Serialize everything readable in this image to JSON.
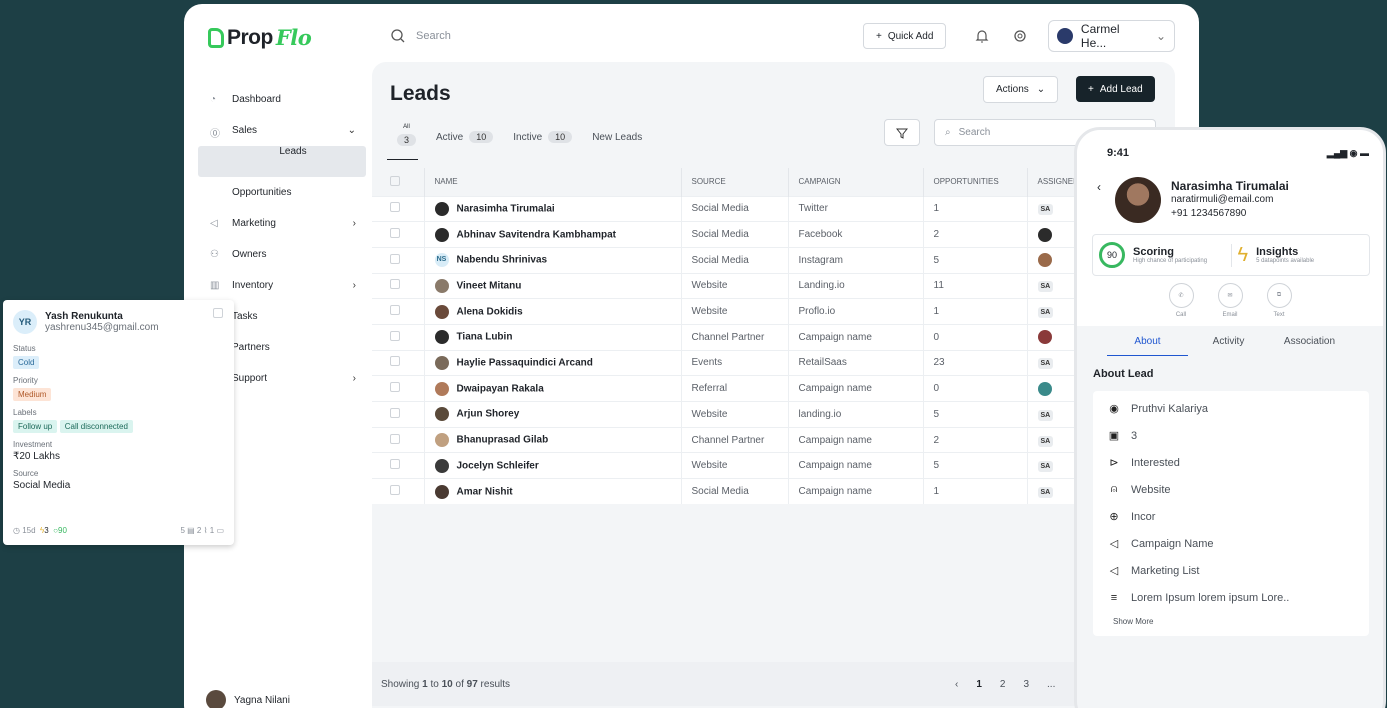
{
  "brand": {
    "name_a": "Prop",
    "name_b": "Flo"
  },
  "top": {
    "search_placeholder": "Search",
    "quick_add": "Quick Add",
    "user": "Carmel He..."
  },
  "sidebar": {
    "items": [
      {
        "label": "Dashboard"
      },
      {
        "label": "Sales"
      },
      {
        "label": "Leads"
      },
      {
        "label": "Opportunities"
      },
      {
        "label": "Marketing"
      },
      {
        "label": "Owners"
      },
      {
        "label": "Inventory"
      },
      {
        "label": "Tasks"
      },
      {
        "label": "Partners"
      },
      {
        "label": "Support"
      }
    ],
    "footer_user": "Yagna Nilani"
  },
  "page": {
    "title": "Leads",
    "actions": "Actions",
    "add_lead": "Add Lead",
    "search_placeholder": "Search"
  },
  "tabs": [
    {
      "label": "All",
      "count": "3"
    },
    {
      "label": "Active",
      "count": "10"
    },
    {
      "label": "Inctive",
      "count": "10"
    },
    {
      "label": "New Leads",
      "count": ""
    }
  ],
  "columns": [
    "NAME",
    "SOURCE",
    "CAMPAIGN",
    "OPPORTUNITIES",
    "ASSIGNED"
  ],
  "rows": [
    {
      "name": "Narasimha Tirumalai",
      "source": "Social Media",
      "campaign": "Twitter",
      "opp": "1",
      "assigned": "SA"
    },
    {
      "name": "Abhinav Savitendra Kambhampat",
      "source": "Social Media",
      "campaign": "Facebook",
      "opp": "2",
      "assigned": ""
    },
    {
      "name": "Nabendu Shrinivas",
      "initials": "NS",
      "source": "Social Media",
      "campaign": "Instagram",
      "opp": "5",
      "assigned": ""
    },
    {
      "name": "Vineet Mitanu",
      "source": "Website",
      "campaign": "Landing.io",
      "opp": "11",
      "assigned": "SA"
    },
    {
      "name": "Alena Dokidis",
      "source": "Website",
      "campaign": "Proflo.io",
      "opp": "1",
      "assigned": "SA"
    },
    {
      "name": "Tiana Lubin",
      "source": "Channel Partner",
      "campaign": "Campaign name",
      "opp": "0",
      "assigned": ""
    },
    {
      "name": "Haylie Passaquindici Arcand",
      "source": "Events",
      "campaign": "RetailSaas",
      "opp": "23",
      "assigned": "SA"
    },
    {
      "name": "Dwaipayan Rakala",
      "source": "Referral",
      "campaign": "Campaign name",
      "opp": "0",
      "assigned": ""
    },
    {
      "name": "Arjun Shorey",
      "source": "Website",
      "campaign": "landing.io",
      "opp": "5",
      "assigned": "SA"
    },
    {
      "name": "Bhanuprasad Gilab",
      "source": "Channel Partner",
      "campaign": "Campaign name",
      "opp": "2",
      "assigned": "SA"
    },
    {
      "name": "Jocelyn Schleifer",
      "source": "Website",
      "campaign": "Campaign name",
      "opp": "5",
      "assigned": "SA"
    },
    {
      "name": "Amar Nishit",
      "source": "Social Media",
      "campaign": "Campaign name",
      "opp": "1",
      "assigned": "SA"
    }
  ],
  "pager": {
    "showing": "Showing",
    "from": "1",
    "to_word": "to",
    "to": "10",
    "of_word": "of",
    "total": "97",
    "results": "results",
    "pages": [
      "1",
      "2",
      "3",
      "..."
    ]
  },
  "card": {
    "initials": "YR",
    "name": "Yash Renukunta",
    "email": "yashrenu345@gmail.com",
    "status_label": "Status",
    "status": "Cold",
    "priority_label": "Priority",
    "priority": "Medium",
    "labels_label": "Labels",
    "labels": [
      "Follow up",
      "Call disconnected"
    ],
    "investment_label": "Investment",
    "investment": "₹20 Lakhs",
    "source_label": "Source",
    "source": "Social Media",
    "days": "15d",
    "bolt": "3",
    "score": "90",
    "docs": "5",
    "attach": "2",
    "comments": "1"
  },
  "phone": {
    "time": "9:41",
    "name": "Narasimha Tirumalai",
    "email": "naratirmuli@email.com",
    "phone": "+91 1234567890",
    "score": "90",
    "scoring": "Scoring",
    "scoring_sub": "High chance of participating",
    "insights": "Insights",
    "insights_sub": "5 datapoints available",
    "call": "Call",
    "email_btn": "Email",
    "text": "Text",
    "tabs": [
      "About",
      "Activity",
      "Association"
    ],
    "about_title": "About Lead",
    "about": [
      "Pruthvi Kalariya",
      "3",
      "Interested",
      "Website",
      "Incor",
      "Campaign Name",
      "Marketing List",
      "Lorem Ipsum lorem ipsum Lore.."
    ],
    "show_more": "Show More"
  }
}
